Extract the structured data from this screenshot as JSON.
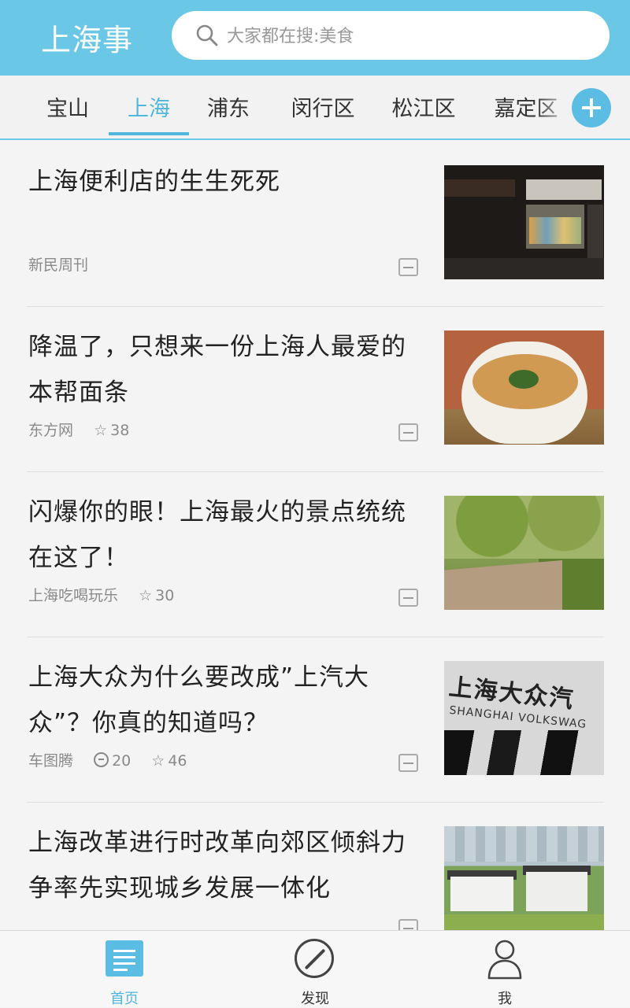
{
  "header": {
    "app_title": "上海事",
    "search_placeholder": "大家都在搜:美食"
  },
  "tabs": [
    {
      "label": "宝山",
      "active": false
    },
    {
      "label": "上海",
      "active": true
    },
    {
      "label": "浦东",
      "active": false
    },
    {
      "label": "闵行区",
      "active": false
    },
    {
      "label": "松江区",
      "active": false
    },
    {
      "label": "嘉定区",
      "active": false
    }
  ],
  "feed": [
    {
      "title": "上海便利店的生生死死",
      "source": "新民周刊",
      "comments": "",
      "stars": "",
      "thumb": "convenience-store-photo"
    },
    {
      "title": "降温了，只想来一份上海人最爱的本帮面条",
      "source": "东方网",
      "comments": "",
      "stars": "38",
      "thumb": "noodle-bowl-photo"
    },
    {
      "title": "闪爆你的眼！上海最火的景点统统在这了！",
      "source": "上海吃喝玩乐",
      "comments": "",
      "stars": "30",
      "thumb": "park-road-photo"
    },
    {
      "title": "上海大众为什么要改成”上汽大众”？你真的知道吗？",
      "source": "车图腾",
      "comments": "20",
      "stars": "46",
      "thumb": "volkswagen-sign-photo",
      "thumb_text_1": "上海大众汽",
      "thumb_text_2": "SHANGHAI VOLKSWAG"
    },
    {
      "title": "上海改革进行时改革向郊区倾斜力争率先实现城乡发展一体化",
      "source": "",
      "comments": "",
      "stars": "",
      "thumb": "suburban-town-photo"
    }
  ],
  "bottom_nav": [
    {
      "label": "首页",
      "icon": "home-list-icon",
      "active": true
    },
    {
      "label": "发现",
      "icon": "compass-icon",
      "active": false
    },
    {
      "label": "我",
      "icon": "user-icon",
      "active": false
    }
  ],
  "colors": {
    "accent": "#6ac7e6",
    "active_text": "#4fb6dd"
  }
}
